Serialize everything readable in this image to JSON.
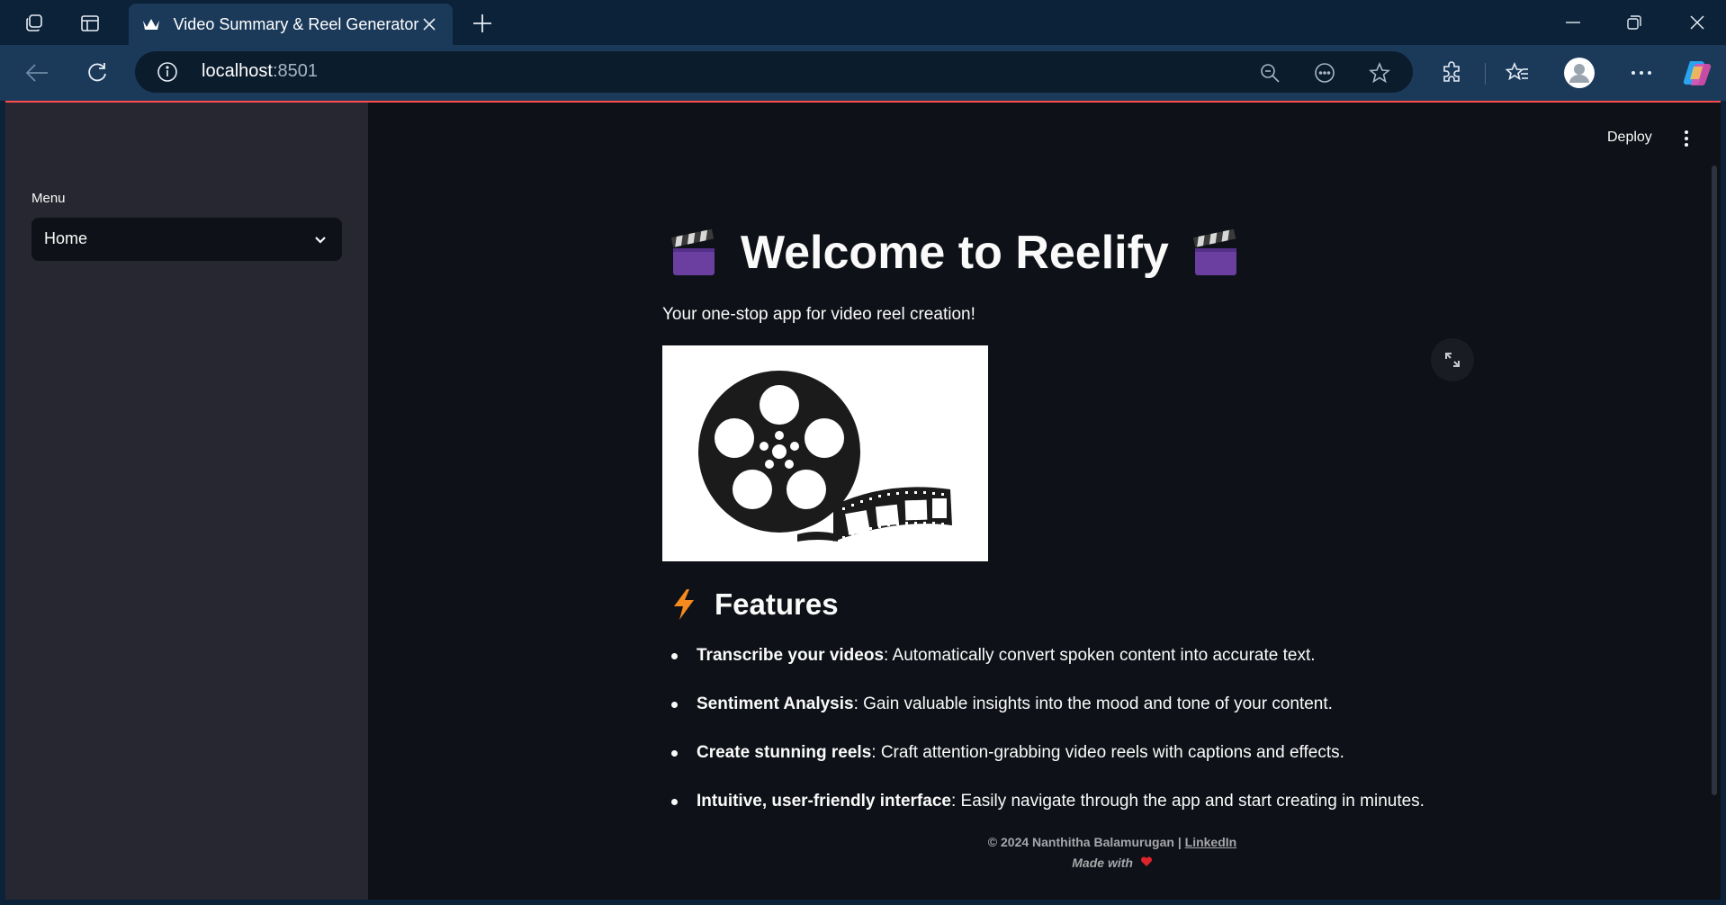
{
  "browser": {
    "tab_title": "Video Summary & Reel Generator",
    "url_host": "localhost",
    "url_port": ":8501"
  },
  "sidebar": {
    "menu_label": "Menu",
    "menu_selected": "Home"
  },
  "header": {
    "deploy_label": "Deploy"
  },
  "main": {
    "title": "Welcome to Reelify",
    "subtitle": "Your one-stop app for video reel creation!",
    "features_heading": "Features",
    "features": [
      {
        "bold": "Transcribe your videos",
        "text": ": Automatically convert spoken content into accurate text."
      },
      {
        "bold": "Sentiment Analysis",
        "text": ": Gain valuable insights into the mood and tone of your content."
      },
      {
        "bold": "Create stunning reels",
        "text": ": Craft attention-grabbing video reels with captions and effects."
      },
      {
        "bold": "Intuitive, user-friendly interface",
        "text": ": Easily navigate through the app and start creating in minutes."
      }
    ]
  },
  "footer": {
    "copyright": "© 2024 Nanthitha Balamurugan | ",
    "link_label": "LinkedIn",
    "made_with": "Made with"
  },
  "colors": {
    "accent": "#ff4b4b",
    "page_bg": "#0e1117",
    "sidebar_bg": "#262730",
    "browser_bg": "#0b2239"
  },
  "icons": [
    "apps-icon",
    "tab-actions-icon",
    "crown-favicon-icon",
    "close-icon",
    "plus-icon",
    "minimize-icon",
    "restore-icon",
    "back-icon",
    "refresh-icon",
    "info-icon",
    "zoom-out-icon",
    "read-aloud-icon",
    "star-icon",
    "extensions-icon",
    "favorites-icon",
    "profile-icon",
    "more-icon",
    "copilot-icon",
    "chevron-down-icon",
    "clapper-icon",
    "film-reel-icon",
    "expand-icon",
    "lightning-icon",
    "heart-icon"
  ]
}
